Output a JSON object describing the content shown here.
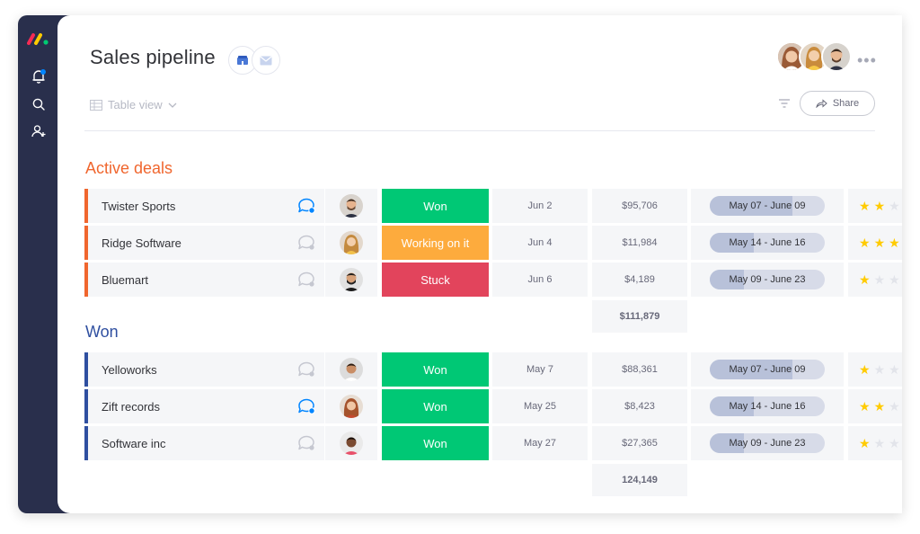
{
  "board": {
    "title": "Sales pipeline",
    "view_label": "Table view",
    "share_label": "Share"
  },
  "colors": {
    "sidebar_bg": "#292f4c",
    "status_won": "#00c875",
    "status_working": "#fdab3d",
    "status_stuck": "#e2445c",
    "group_active": "#f0662e",
    "group_won": "#2f4fa0",
    "star_on": "#ffcb00",
    "star_off": "#e2e4ea",
    "notification_dot": "#0085ff"
  },
  "groups": [
    {
      "title": "Active deals",
      "rows": [
        {
          "name": "Twister Sports",
          "status": "Won",
          "date": "Jun 2",
          "value": "$95,706",
          "timeline": "May 07 - June 09",
          "timeline_progress": 0.72,
          "rating": 2,
          "chat_active": true
        },
        {
          "name": "Ridge Software",
          "status": "Working on it",
          "date": "Jun 4",
          "value": "$11,984",
          "timeline": "May 14 - June 16",
          "timeline_progress": 0.38,
          "rating": 3,
          "chat_active": false
        },
        {
          "name": "Bluemart",
          "status": "Stuck",
          "date": "Jun 6",
          "value": "$4,189",
          "timeline": "May 09 - June 23",
          "timeline_progress": 0.3,
          "rating": 1,
          "chat_active": false
        }
      ],
      "sum": "$111,879"
    },
    {
      "title": "Won",
      "rows": [
        {
          "name": "Yelloworks",
          "status": "Won",
          "date": "May 7",
          "value": "$88,361",
          "timeline": "May 07 - June 09",
          "timeline_progress": 0.72,
          "rating": 1,
          "chat_active": false
        },
        {
          "name": "Zift records",
          "status": "Won",
          "date": "May 25",
          "value": "$8,423",
          "timeline": "May 14 - June 16",
          "timeline_progress": 0.38,
          "rating": 2,
          "chat_active": true
        },
        {
          "name": "Software inc",
          "status": "Won",
          "date": "May 27",
          "value": "$27,365",
          "timeline": "May 09 - June 23",
          "timeline_progress": 0.3,
          "rating": 1,
          "chat_active": false
        }
      ],
      "sum": "124,149"
    }
  ],
  "icons": {
    "sidebar": [
      "bell-icon",
      "search-icon",
      "add-user-icon"
    ],
    "header": [
      "building-icon",
      "mail-icon",
      "more-icon",
      "filter-icon",
      "share-arrow-icon"
    ],
    "rows": [
      "chat-icon",
      "star-icon"
    ]
  }
}
